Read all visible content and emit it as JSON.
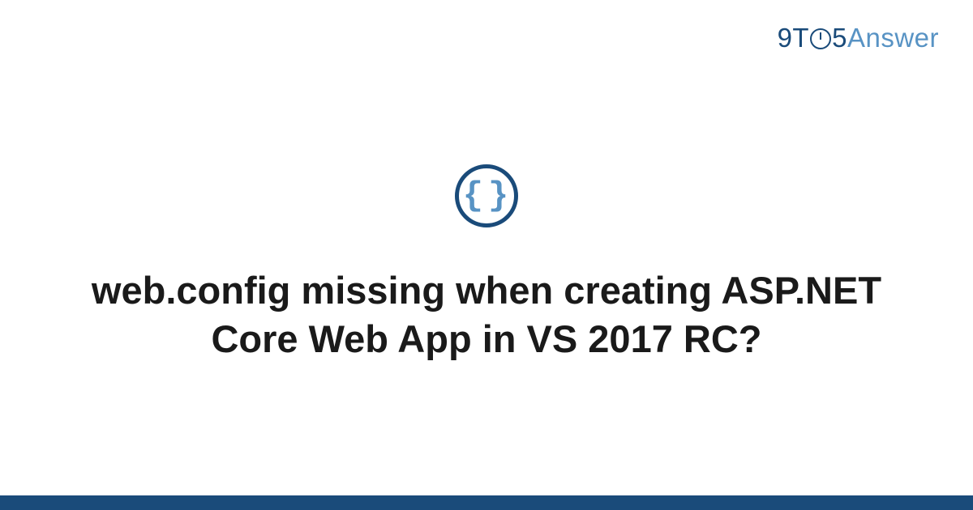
{
  "brand": {
    "part1": "9T",
    "part2": "5",
    "part3": "Answer"
  },
  "icon": {
    "name": "code-braces-icon",
    "glyph": "{}"
  },
  "main": {
    "title": "web.config missing when creating ASP.NET Core Web App in VS 2017 RC?"
  },
  "colors": {
    "primary": "#1a4b7a",
    "accent": "#5893c4",
    "background": "#ffffff",
    "text": "#1a1a1a"
  }
}
